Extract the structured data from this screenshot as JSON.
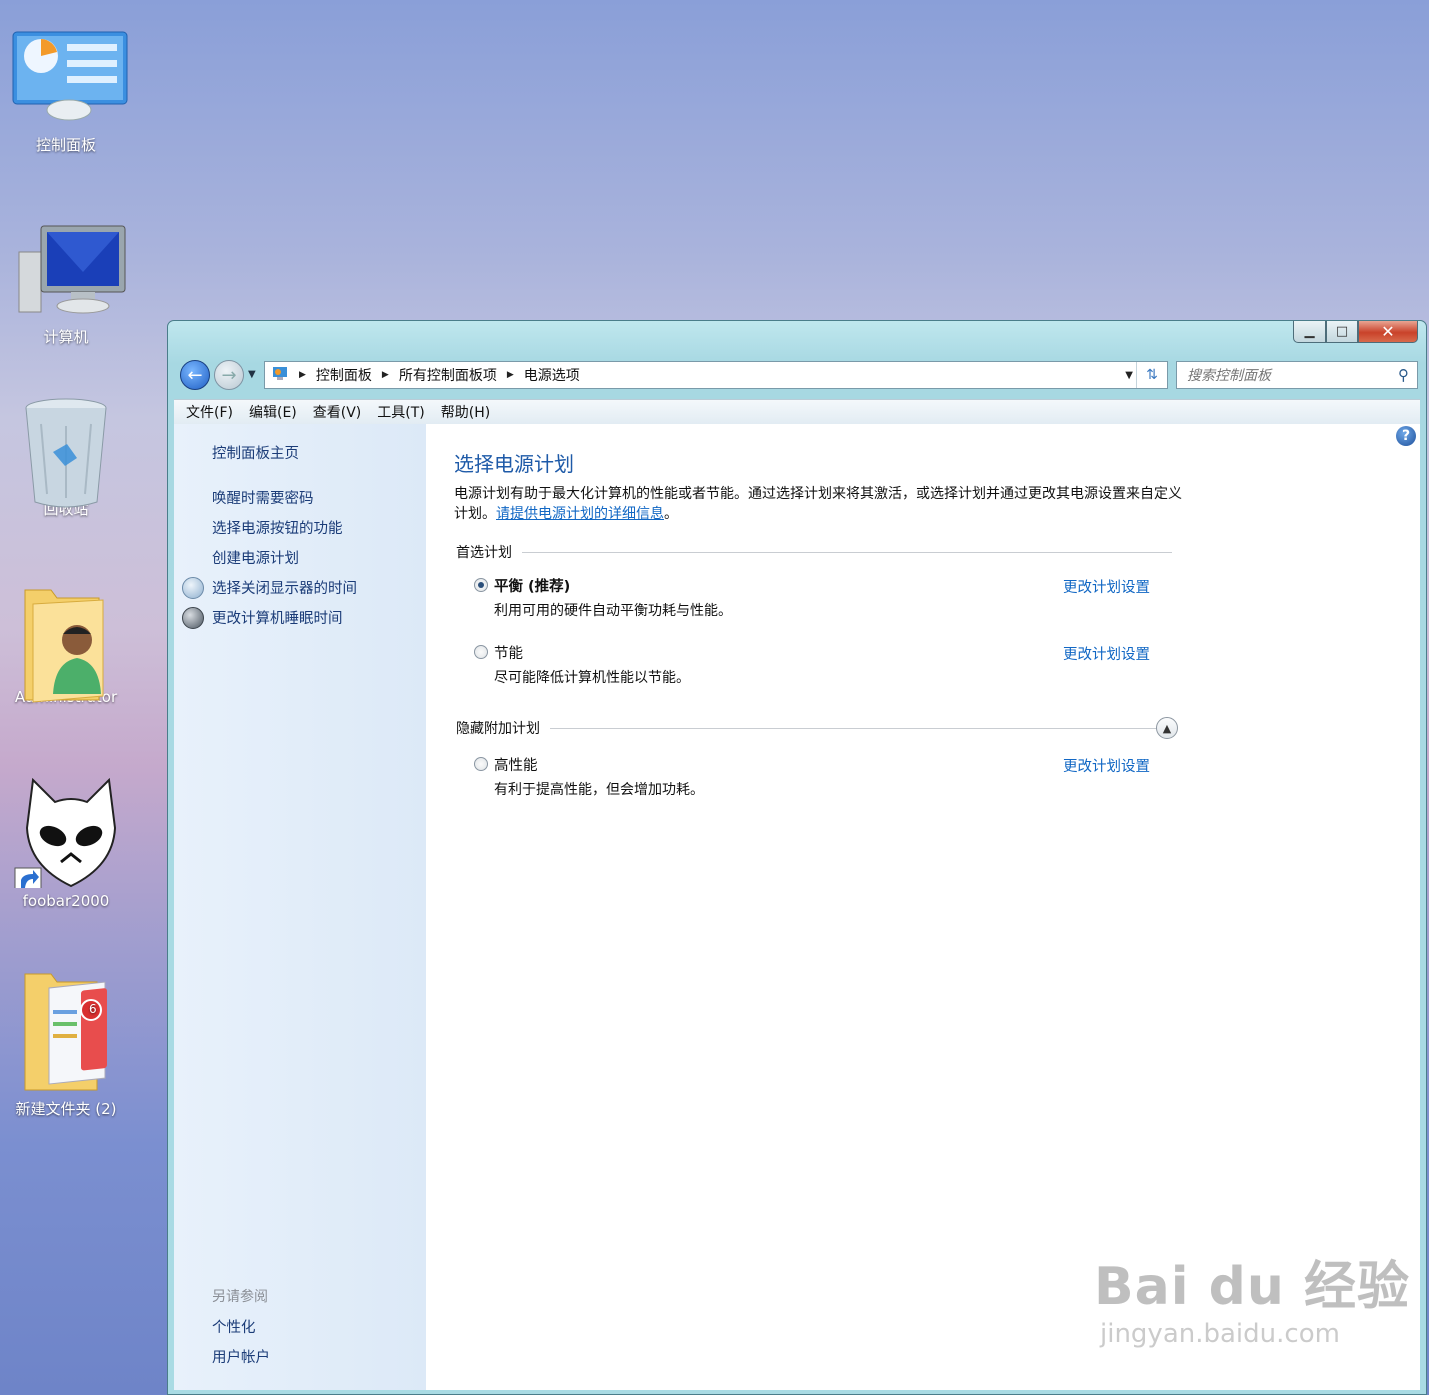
{
  "desktop": {
    "icons": [
      {
        "label": "控制面板"
      },
      {
        "label": "计算机"
      },
      {
        "label": "回收站"
      },
      {
        "label": "Administrator"
      },
      {
        "label": "foobar2000"
      },
      {
        "label": "新建文件夹 (2)"
      }
    ],
    "badge_count": "6"
  },
  "window": {
    "controls": {
      "minimize": "▁",
      "maximize": "□",
      "close": "✕"
    },
    "breadcrumb": [
      "控制面板",
      "所有控制面板项",
      "电源选项"
    ],
    "search_placeholder": "搜索控制面板",
    "menu": [
      "文件(F)",
      "编辑(E)",
      "查看(V)",
      "工具(T)",
      "帮助(H)"
    ]
  },
  "sidebar": {
    "home": "控制面板主页",
    "links": [
      "唤醒时需要密码",
      "选择电源按钮的功能",
      "创建电源计划",
      "选择关闭显示器的时间",
      "更改计算机睡眠时间"
    ],
    "see_also": "另请参阅",
    "see_also_links": [
      "个性化",
      "用户帐户"
    ]
  },
  "main": {
    "title": "选择电源计划",
    "description": "电源计划有助于最大化计算机的性能或者节能。通过选择计划来将其激活，或选择计划并通过更改其电源设置来自定义计划。",
    "description_link": "请提供电源计划的详细信息",
    "description_end": "。",
    "preferred_label": "首选计划",
    "hidden_label": "隐藏附加计划",
    "plans": [
      {
        "name": "平衡 (推荐)",
        "desc": "利用可用的硬件自动平衡功耗与性能。",
        "link": "更改计划设置",
        "selected": true
      },
      {
        "name": "节能",
        "desc": "尽可能降低计算机性能以节能。",
        "link": "更改计划设置",
        "selected": false
      },
      {
        "name": "高性能",
        "desc": "有利于提高性能，但会增加功耗。",
        "link": "更改计划设置",
        "selected": false
      }
    ]
  },
  "watermark": {
    "brand": "Bai du 经验",
    "url": "jingyan.baidu.com"
  },
  "colors": {
    "accent": "#1e5aa8",
    "link": "#1167c4",
    "sidebar_link": "#1b3c78"
  }
}
